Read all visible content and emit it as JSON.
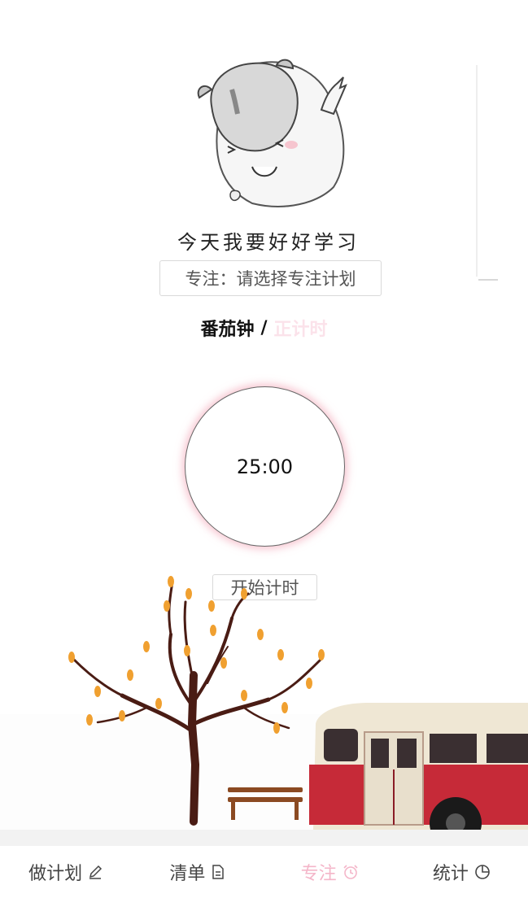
{
  "illustration": {
    "caption": "今天我要好好学习"
  },
  "focus": {
    "plan_label": "专注：请选择专注计划"
  },
  "mode": {
    "active": "番茄钟",
    "separator": "/",
    "inactive": "正计时"
  },
  "timer": {
    "display": "25:00"
  },
  "actions": {
    "start_label": "开始计时"
  },
  "tabs": [
    {
      "label": "做计划",
      "icon": "pencil-icon",
      "active": false
    },
    {
      "label": "清单",
      "icon": "document-icon",
      "active": false
    },
    {
      "label": "专注",
      "icon": "alarm-clock-icon",
      "active": true
    },
    {
      "label": "统计",
      "icon": "pie-chart-icon",
      "active": false
    }
  ],
  "colors": {
    "accent_pink": "#f4b6c9",
    "inactive_mode": "#fbe2ea",
    "timer_glow": "#f096aa",
    "bus_red": "#c62a38",
    "tree_trunk": "#4a1c14",
    "leaf_orange": "#f0a030"
  }
}
